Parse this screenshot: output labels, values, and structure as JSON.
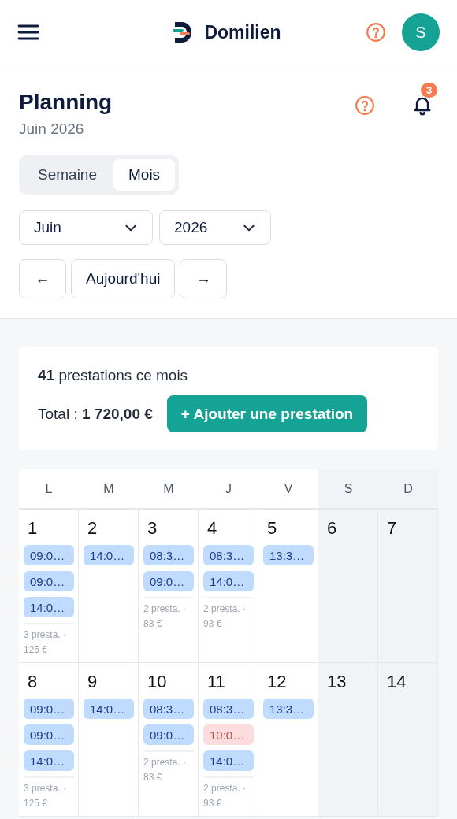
{
  "topbar": {
    "brand": "Domilien",
    "avatar": "S"
  },
  "page": {
    "title": "Planning",
    "subtitle": "Juin 2026",
    "notifications": "3"
  },
  "view_toggle": [
    {
      "label": "Semaine",
      "selected": false
    },
    {
      "label": "Mois",
      "selected": true
    }
  ],
  "month_select": {
    "value": "Juin"
  },
  "year_select": {
    "value": "2026"
  },
  "nav": {
    "prev": "←",
    "today": "Aujourd'hui",
    "next": "→"
  },
  "summary": {
    "count_text": "**41** prestations ce mois",
    "total_text": "Total : **1 720,00 €**",
    "add_button": "+ Ajouter une prestation"
  },
  "calendar": {
    "weekdays": [
      {
        "label": "L",
        "weekend": false
      },
      {
        "label": "M",
        "weekend": false
      },
      {
        "label": "M",
        "weekend": false
      },
      {
        "label": "J",
        "weekend": false
      },
      {
        "label": "V",
        "weekend": false
      },
      {
        "label": "S",
        "weekend": true
      },
      {
        "label": "D",
        "weekend": true
      }
    ],
    "weeks": [
      [
        {
          "day": "1",
          "weekend": false,
          "events": [
            {
              "time": "09:0…",
              "cancelled": false
            },
            {
              "time": "09:0…",
              "cancelled": false
            },
            {
              "time": "14:0…",
              "cancelled": false
            }
          ],
          "summary": "3 presta. · 125 €"
        },
        {
          "day": "2",
          "weekend": false,
          "events": [
            {
              "time": "14:0…",
              "cancelled": false
            }
          ]
        },
        {
          "day": "3",
          "weekend": false,
          "events": [
            {
              "time": "08:3…",
              "cancelled": false
            },
            {
              "time": "09:0…",
              "cancelled": false
            }
          ],
          "summary": "2 presta. · 83 €"
        },
        {
          "day": "4",
          "weekend": false,
          "events": [
            {
              "time": "08:3…",
              "cancelled": false
            },
            {
              "time": "14:0…",
              "cancelled": false
            }
          ],
          "summary": "2 presta. · 93 €"
        },
        {
          "day": "5",
          "weekend": false,
          "events": [
            {
              "time": "13:3…",
              "cancelled": false
            }
          ]
        },
        {
          "day": "6",
          "weekend": true
        },
        {
          "day": "7",
          "weekend": true
        }
      ],
      [
        {
          "day": "8",
          "weekend": false,
          "events": [
            {
              "time": "09:0…",
              "cancelled": false
            },
            {
              "time": "09:0…",
              "cancelled": false
            },
            {
              "time": "14:0…",
              "cancelled": false
            }
          ],
          "summary": "3 presta. · 125 €"
        },
        {
          "day": "9",
          "weekend": false,
          "events": [
            {
              "time": "14:0…",
              "cancelled": false
            }
          ]
        },
        {
          "day": "10",
          "weekend": false,
          "events": [
            {
              "time": "08:3…",
              "cancelled": false
            },
            {
              "time": "09:0…",
              "cancelled": false
            }
          ],
          "summary": "2 presta. · 83 €"
        },
        {
          "day": "11",
          "weekend": false,
          "events": [
            {
              "time": "08:3…",
              "cancelled": false
            },
            {
              "time": "10:0…",
              "cancelled": true
            },
            {
              "time": "14:0…",
              "cancelled": false
            }
          ],
          "summary": "2 presta. · 93 €"
        },
        {
          "day": "12",
          "weekend": false,
          "events": [
            {
              "time": "13:3…",
              "cancelled": false
            }
          ]
        },
        {
          "day": "13",
          "weekend": true
        },
        {
          "day": "14",
          "weekend": true
        }
      ]
    ]
  }
}
